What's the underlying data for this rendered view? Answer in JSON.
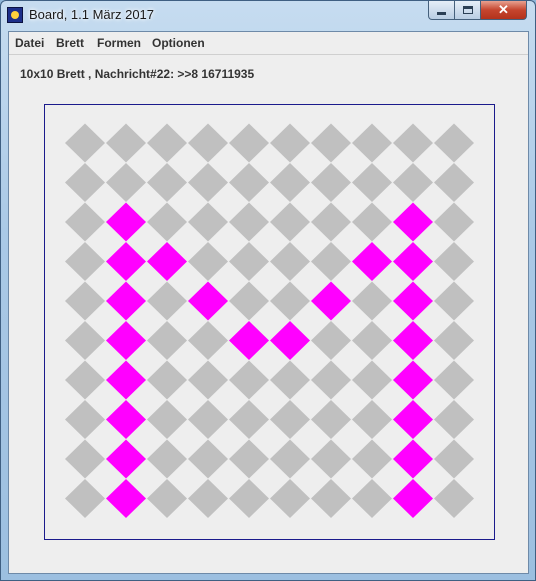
{
  "window": {
    "title": "Board, 1.1 März 2017",
    "controls": {
      "minimize": "minimize",
      "maximize": "maximize",
      "close": "close"
    }
  },
  "menu": {
    "items": [
      {
        "label": "Datei"
      },
      {
        "label": "Brett"
      },
      {
        "label": "Formen"
      },
      {
        "label": "Optionen"
      }
    ]
  },
  "status": {
    "text": "10x10 Brett , Nachricht#22: >>8 16711935"
  },
  "board": {
    "rows": 10,
    "cols": 10,
    "default_color": "#c0c0c0",
    "highlight_color": "#ff00ff",
    "highlighted_cells": [
      [
        2,
        1
      ],
      [
        2,
        8
      ],
      [
        3,
        1
      ],
      [
        3,
        2
      ],
      [
        3,
        7
      ],
      [
        3,
        8
      ],
      [
        4,
        1
      ],
      [
        4,
        3
      ],
      [
        4,
        6
      ],
      [
        4,
        8
      ],
      [
        5,
        1
      ],
      [
        5,
        4
      ],
      [
        5,
        5
      ],
      [
        5,
        8
      ],
      [
        6,
        1
      ],
      [
        6,
        8
      ],
      [
        7,
        1
      ],
      [
        7,
        8
      ],
      [
        8,
        1
      ],
      [
        8,
        8
      ],
      [
        9,
        1
      ],
      [
        9,
        8
      ]
    ]
  }
}
